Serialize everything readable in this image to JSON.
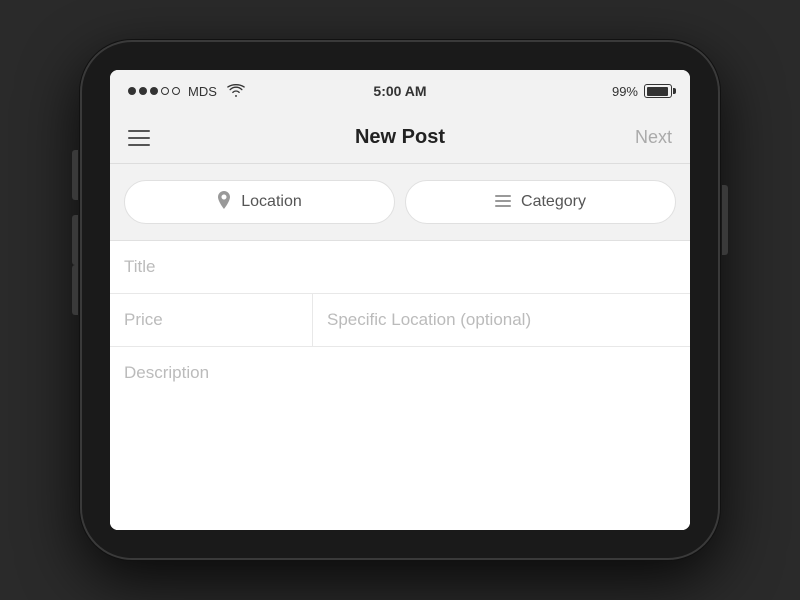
{
  "statusBar": {
    "carrier": "MDS",
    "time": "5:00 AM",
    "battery": "99%",
    "signalDots": [
      {
        "filled": true
      },
      {
        "filled": true
      },
      {
        "filled": true
      },
      {
        "filled": false
      },
      {
        "filled": false
      }
    ]
  },
  "navBar": {
    "title": "New Post",
    "nextLabel": "Next"
  },
  "filterButtons": [
    {
      "icon": "📍",
      "label": "Location",
      "iconType": "pin"
    },
    {
      "icon": "≡",
      "label": "Category",
      "iconType": "list"
    }
  ],
  "formFields": {
    "title": {
      "placeholder": "Title"
    },
    "price": {
      "placeholder": "Price"
    },
    "specificLocation": {
      "placeholder": "Specific Location (optional)"
    },
    "description": {
      "placeholder": "Description"
    }
  }
}
